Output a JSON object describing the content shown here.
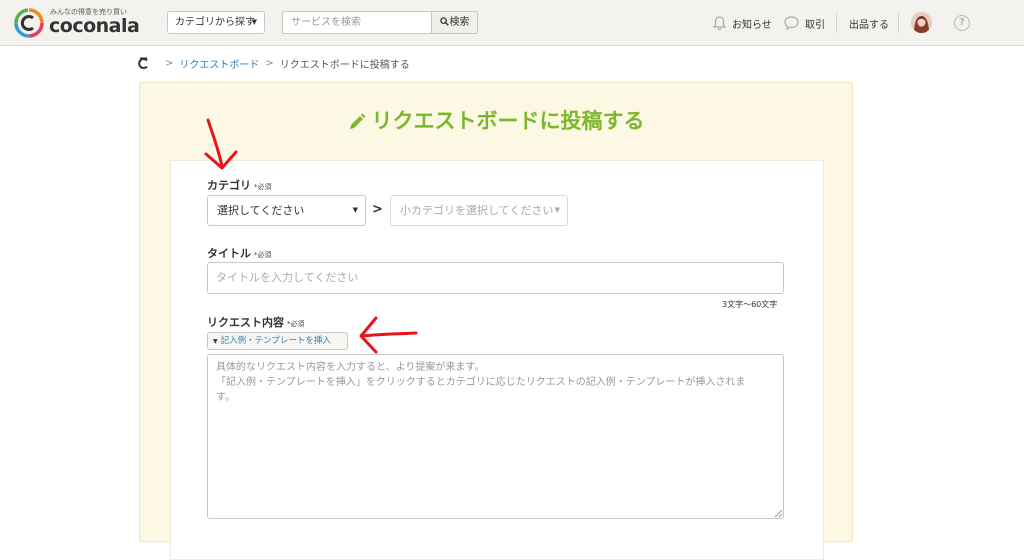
{
  "header": {
    "logo_tagline": "みんなの得意を売り買い",
    "logo_text": "coconala",
    "category_button": "カテゴリから探す",
    "search_placeholder": "サービスを検索",
    "search_button": "検索",
    "notifications": "お知らせ",
    "transactions": "取引",
    "sell": "出品する"
  },
  "breadcrumb": {
    "items": [
      "リクエストボード",
      "リクエストボードに投稿する"
    ]
  },
  "page": {
    "title": "リクエストボードに投稿する"
  },
  "form": {
    "required_mark": "*必須",
    "category": {
      "label": "カテゴリ",
      "main_value": "選択してください",
      "sub_value": "小カテゴリを選択してください"
    },
    "title_field": {
      "label": "タイトル",
      "placeholder": "タイトルを入力してください",
      "hint": "3文字〜60文字"
    },
    "content": {
      "label": "リクエスト内容",
      "template_button": "記入例・テンプレートを挿入",
      "placeholder_line1": "具体的なリクエスト内容を入力すると、より提案が来ます。",
      "placeholder_line2": "「記入例・テンプレートを挿入」をクリックするとカテゴリに応じたリクエストの記入例・テンプレートが挿入されま",
      "placeholder_line3": "す。"
    }
  },
  "colors": {
    "accent_green": "#7ab82a",
    "link_blue": "#2a7fb8",
    "panel_cream": "#fdf8e3",
    "annotation_red": "#e8141c"
  }
}
